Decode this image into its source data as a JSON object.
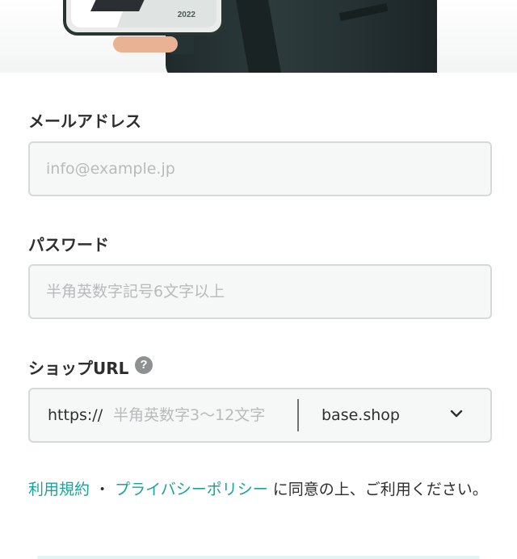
{
  "hero": {
    "phone_year": "2022"
  },
  "form": {
    "email": {
      "label": "メールアドレス",
      "value": "",
      "placeholder": "info@example.jp"
    },
    "password": {
      "label": "パスワード",
      "value": "",
      "placeholder": "半角英数字記号6文字以上"
    },
    "shop_url": {
      "label": "ショップURL",
      "help_icon": "?",
      "prefix": "https://",
      "value": "",
      "placeholder": "半角英数字3〜12文字",
      "domain_selected": "base.shop",
      "domain_icon": "chevron-down-icon"
    }
  },
  "agreement": {
    "terms_link": "利用規約",
    "separator": "・",
    "privacy_link": "プライバシーポリシー",
    "suffix": "に同意の上、ご利用ください。"
  },
  "colors": {
    "link": "#1aa39a",
    "field_background": "#f6f7f7",
    "field_border": "#d6d9d9",
    "label_text": "#2e2e2e"
  }
}
